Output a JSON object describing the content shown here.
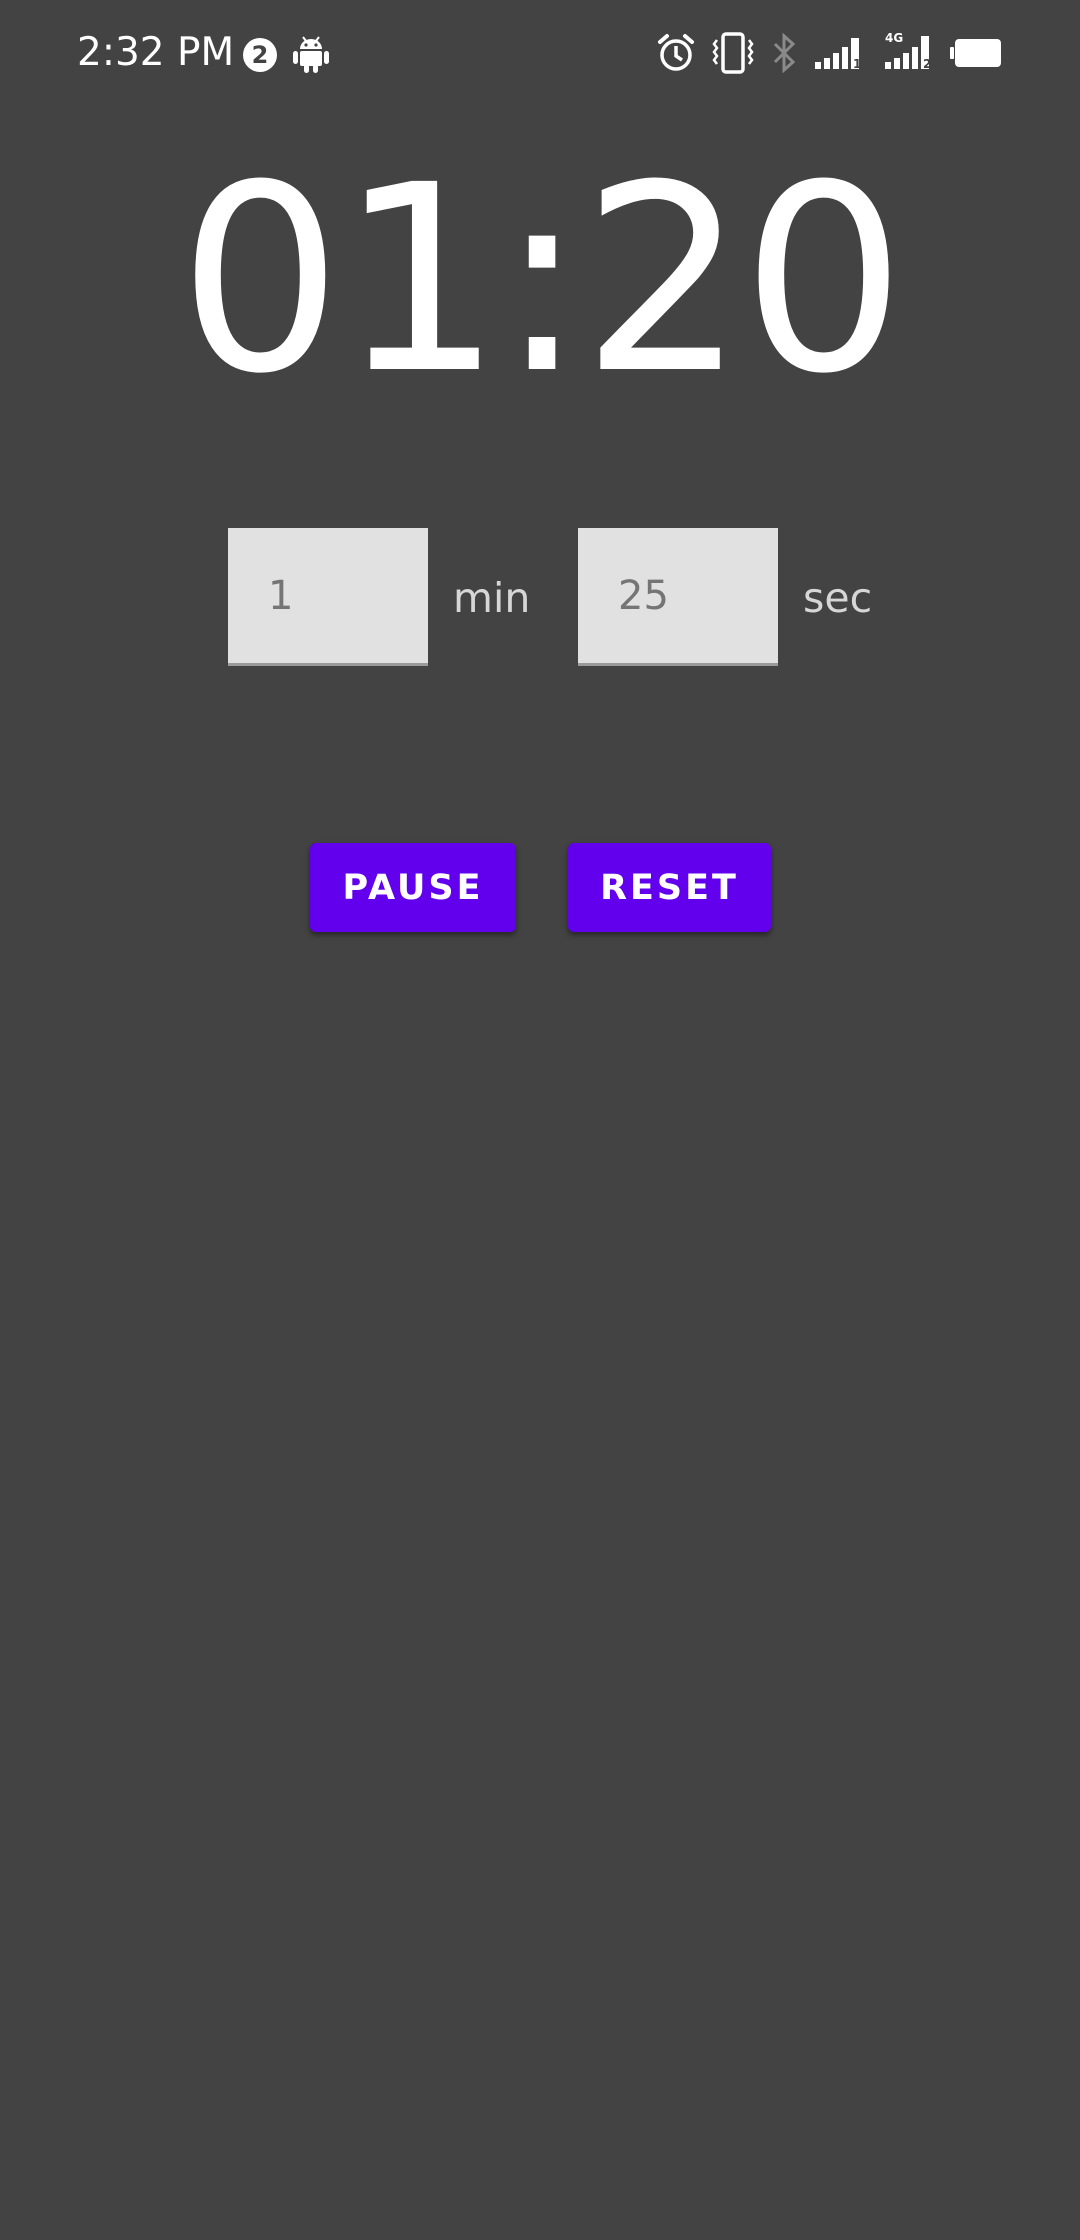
{
  "status_bar": {
    "time": "2:32 PM",
    "notification_count": "2",
    "icons": [
      "android-icon",
      "alarm-icon",
      "vibrate-icon",
      "bluetooth-icon",
      "signal-sim1-icon",
      "signal-sim2-4g-icon",
      "battery-icon"
    ],
    "sim1_label": "1",
    "sim2_label": "2",
    "network_type": "4G"
  },
  "timer": {
    "display": "01:20"
  },
  "inputs": {
    "minutes": {
      "value": "",
      "placeholder": "1",
      "unit": "min"
    },
    "seconds": {
      "value": "",
      "placeholder": "25",
      "unit": "sec"
    }
  },
  "buttons": {
    "pause_label": "PAUSE",
    "reset_label": "RESET"
  },
  "colors": {
    "background": "#434343",
    "accent": "#6200ee",
    "input_background": "#e1e1e1"
  }
}
